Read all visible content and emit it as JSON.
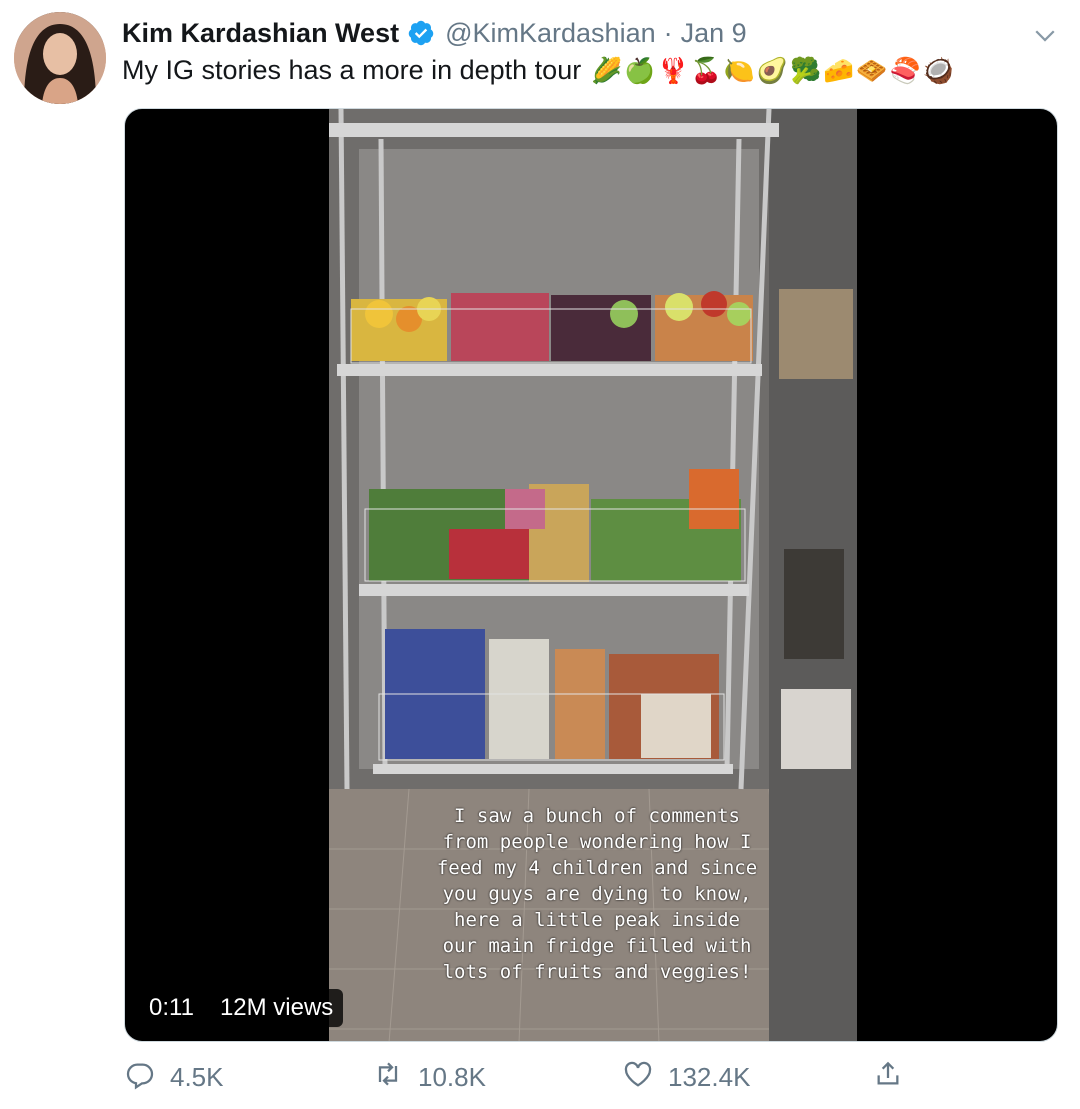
{
  "tweet": {
    "display_name": "Kim Kardashian West",
    "handle": "@KimKardashian",
    "separator": "·",
    "date": "Jan 9",
    "text": "My IG stories has a more in depth tour",
    "emojis": [
      "🌽",
      "🍏",
      "🦞",
      "🍒",
      "🍋",
      "🥑",
      "🥦",
      "🧀",
      "🧇",
      "🍣",
      "🥥"
    ]
  },
  "media": {
    "caption": "I saw a bunch of comments\nfrom people wondering how I\nfeed my 4 children and since\nyou guys are dying to know,\nhere a little peak inside\nour main fridge filled with\nlots of fruits and veggies!",
    "duration": "0:11",
    "views": "12M views"
  },
  "actions": {
    "replies": "4.5K",
    "retweets": "10.8K",
    "likes": "132.4K"
  },
  "colors": {
    "text_primary": "#14171a",
    "text_secondary": "#657786",
    "verified": "#1da1f2"
  },
  "icons": {
    "verified": "verified-badge-icon",
    "menu": "chevron-down-icon",
    "reply": "reply-icon",
    "retweet": "retweet-icon",
    "like": "heart-icon",
    "share": "share-icon"
  }
}
